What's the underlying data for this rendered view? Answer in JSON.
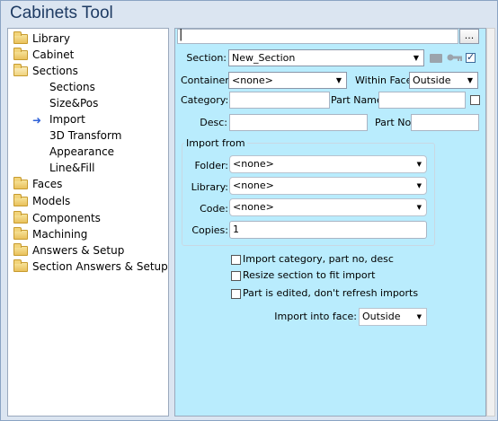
{
  "window": {
    "title": "Cabinets Tool"
  },
  "tree": {
    "items": [
      {
        "label": "Library",
        "icon": "folder-icon"
      },
      {
        "label": "Cabinet",
        "icon": "folder-icon"
      },
      {
        "label": "Sections",
        "icon": "folder-open-icon"
      },
      {
        "label": "Sections",
        "icon": null
      },
      {
        "label": "Size&Pos",
        "icon": null
      },
      {
        "label": "Import",
        "icon": "selected-arrow-icon"
      },
      {
        "label": "3D Transform",
        "icon": null
      },
      {
        "label": "Appearance",
        "icon": null
      },
      {
        "label": "Line&Fill",
        "icon": null
      },
      {
        "label": "Faces",
        "icon": "folder-icon"
      },
      {
        "label": "Models",
        "icon": "folder-icon"
      },
      {
        "label": "Components",
        "icon": "folder-icon"
      },
      {
        "label": "Machining",
        "icon": "folder-icon"
      },
      {
        "label": "Answers & Setup",
        "icon": "folder-icon"
      },
      {
        "label": "Section Answers & Setup",
        "icon": "folder-icon"
      }
    ]
  },
  "top": {
    "path_value": "",
    "browse_label": "..."
  },
  "form": {
    "section_label": "Section:",
    "section_value": "New_Section",
    "section_checked": true,
    "container_label": "Container:",
    "container_value": "<none>",
    "within_face_label": "Within Face:",
    "within_face_value": "Outside",
    "category_label": "Category:",
    "category_value": "",
    "part_name_label": "Part Name:",
    "part_name_value": "",
    "part_name_checked": false,
    "desc_label": "Desc:",
    "desc_value": "",
    "part_no_label": "Part No:",
    "part_no_value": ""
  },
  "import_from": {
    "group_label": "Import from",
    "folder_label": "Folder:",
    "folder_value": "<none>",
    "library_label": "Library:",
    "library_value": "<none>",
    "code_label": "Code:",
    "code_value": "<none>",
    "copies_label": "Copies:",
    "copies_value": "1"
  },
  "options": {
    "import_category_label": "Import category, part no, desc",
    "import_category_checked": false,
    "resize_label": "Resize section to fit import",
    "resize_checked": false,
    "part_edited_label": "Part is edited, don't refresh imports",
    "part_edited_checked": false,
    "import_into_face_label": "Import into face:",
    "import_into_face_value": "Outside"
  },
  "colors": {
    "panel_bg": "#b9ecfd",
    "title": "#1e3b63",
    "selected_arrow": "#2f62d8"
  }
}
